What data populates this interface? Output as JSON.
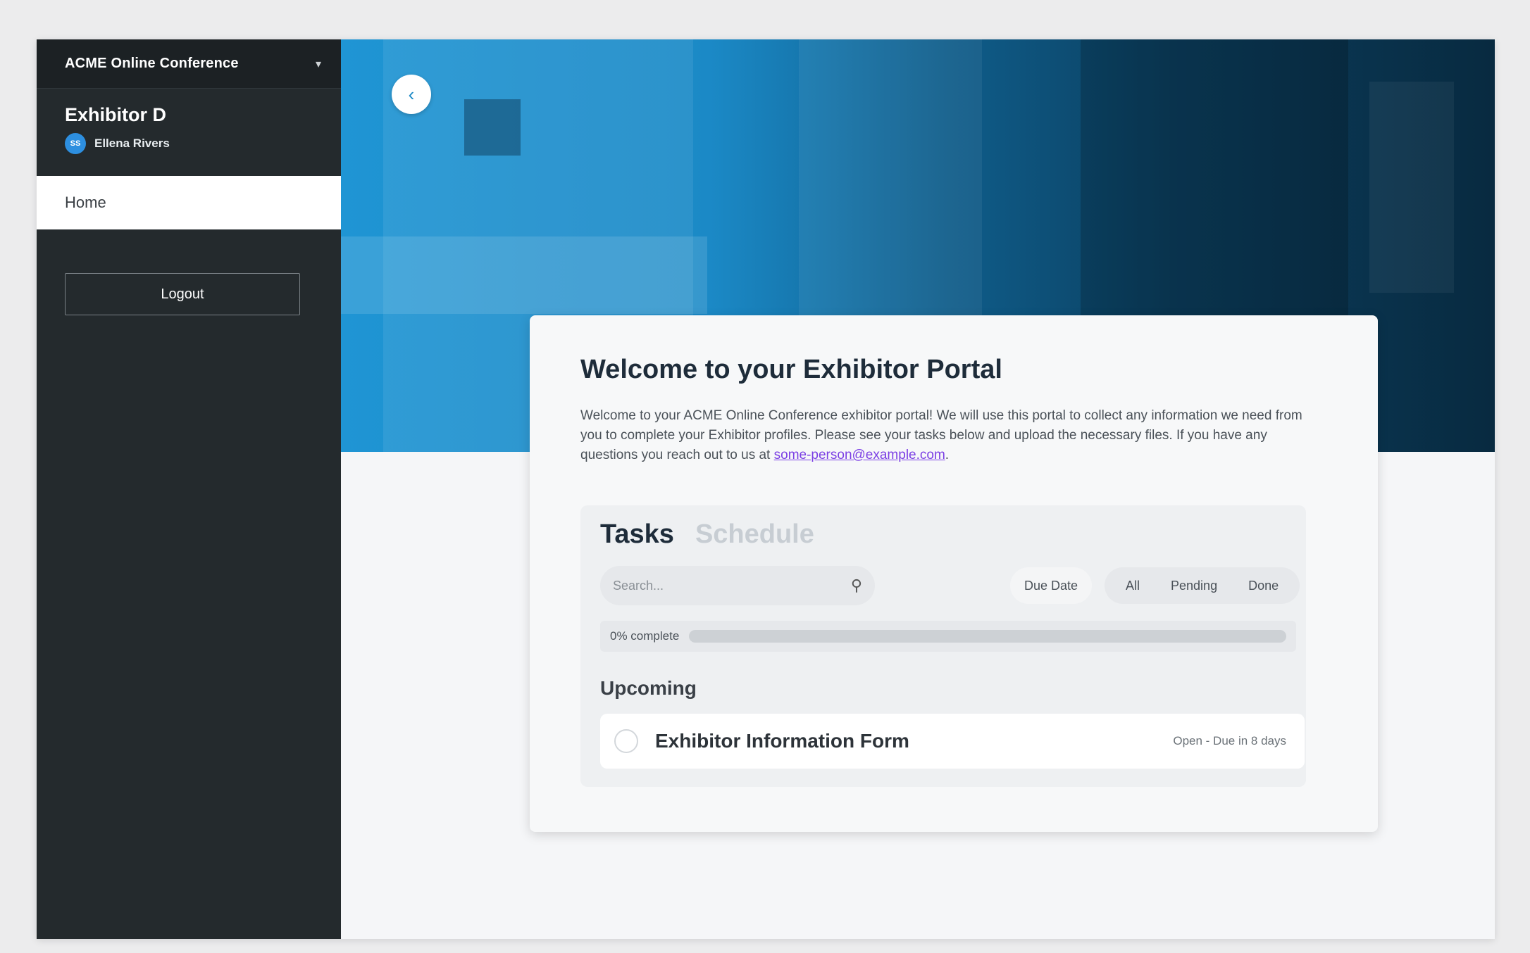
{
  "sidebar": {
    "org_name": "ACME Online Conference",
    "exhibitor_name": "Exhibitor D",
    "user": {
      "initials": "SS",
      "name": "Ellena Rivers"
    },
    "nav": [
      {
        "label": "Home"
      }
    ],
    "logout_label": "Logout"
  },
  "hero": {
    "collapse_icon": "chevron-left-icon",
    "collapse_glyph": "‹"
  },
  "card": {
    "title": "Welcome to your Exhibitor Portal",
    "intro": "Welcome to your ACME Online Conference exhibitor portal! We will use this portal to collect any information we need from you to complete your Exhibitor profiles. Please see your tasks below and upload the necessary files. If you have any questions you reach out to us at ",
    "email": "some-person@example.com",
    "intro_end": "."
  },
  "tasks": {
    "tabs": [
      {
        "label": "Tasks",
        "active": true
      },
      {
        "label": "Schedule",
        "active": false
      }
    ],
    "search_placeholder": "Search...",
    "due_date_label": "Due Date",
    "filters": [
      "All",
      "Pending",
      "Done"
    ],
    "progress_label": "0% complete",
    "progress_value": 0,
    "section_title": "Upcoming",
    "items": [
      {
        "name": "Exhibitor Information Form",
        "status": "Open - Due in 8 days"
      }
    ]
  },
  "colors": {
    "sidebar_bg": "#242a2d",
    "hero_blue": "#1f95d4",
    "link": "#7b3fe4"
  }
}
